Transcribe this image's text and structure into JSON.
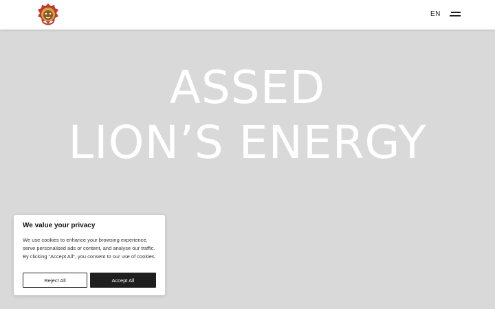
{
  "header": {
    "logo_icon": "lion-head-logo-icon",
    "language": "EN",
    "menu_icon": "hamburger-menu-icon"
  },
  "hero": {
    "line1": "ASSED",
    "line2": "LION’S ENERGY"
  },
  "cookie_banner": {
    "title": "We value your privacy",
    "text": "We use cookies to enhance your browsing experience, serve personalised ads or content, and analyse our traffic. By clicking \"Accept All\", you consent to our use of cookies.",
    "reject_label": "Reject All",
    "accept_label": "Accept All"
  },
  "colors": {
    "background": "#d9d9d9",
    "header": "#ffffff",
    "button_dark": "#1e1e1e"
  }
}
